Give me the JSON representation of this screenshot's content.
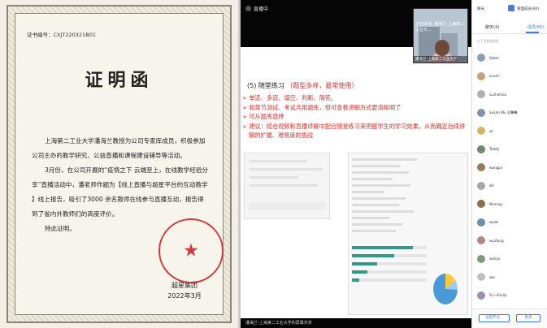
{
  "certificate": {
    "number": "证书编号：CXJT220321B01",
    "title": "证明函",
    "paragraphs": [
      "上海第二工业大学潘海兰教授为公司专家库成员，积极参加公司主办的教学研究、公益直播和课程建设辅导等活动。",
      "3月份，在公司开展的“疫情之下 云端至上，在线教学经验分享”直播活动中，潘老师作题为【线上直播与超星平台的互动教学 】线上报告，吸引了3000 余名教师在线参与直播互动，报告得到了省内外教师们的高度评价。",
      "特此证明。"
    ],
    "signer": "超星集团",
    "date": "2022年3月",
    "seal_color": "#d23c3c"
  },
  "video": {
    "room_title": "直播中",
    "camera_caption": "正在讲话: 潘海兰-上海第二工业大...",
    "camera_label": "潘海兰-上海第二工业大学",
    "slide_heading": "(5) 随堂练习",
    "slide_heading_note": "（题型多样，最常使用）",
    "bullets": [
      "单选、多选、填空、判断、简答。",
      "和章节测试、考试共用题库，但可查看讲解方式更清晰明了",
      "可从题库选择",
      "建议：结合视频和直播讲解中配合随堂练习来把握学生的学习效果，从而确定后续讲解的扩展、难易度的挑战"
    ],
    "bottom_caption": "潘海兰-上海第二工业大学的屏幕共享",
    "practice_results": [
      0.82,
      0.56,
      0.34,
      0.21,
      0.1
    ],
    "pie_shares": [
      0.14,
      0.12,
      0.74
    ]
  },
  "panel": {
    "header_left": "聊天",
    "header_right": "管理成员(80)",
    "tab_chat": "聊天(4)",
    "tab_members": "成员(80)",
    "note": "以下为参会成员",
    "users": [
      {
        "name": "Saber",
        "color": "#8aa0b8"
      },
      {
        "name": "sunoh",
        "color": "#c9a17a"
      },
      {
        "name": "suzhehieu",
        "color": "#b0b0b0"
      },
      {
        "name": "Susan Wu 吴馨馨",
        "color": "#7e95a8"
      },
      {
        "name": "wl",
        "color": "#d8b46a"
      },
      {
        "name": "Teddy",
        "color": "#6d8a6a"
      },
      {
        "name": "wangpv",
        "color": "#9c7c5e"
      },
      {
        "name": "wh",
        "color": "#a7a7a7"
      },
      {
        "name": "Wnniog",
        "color": "#88704d"
      },
      {
        "name": "wode",
        "color": "#6a8db0"
      },
      {
        "name": "wuzfang",
        "color": "#b48484"
      },
      {
        "name": "wuliyu",
        "color": "#7b9c7c"
      },
      {
        "name": "ww",
        "color": "#c0c0c0"
      },
      {
        "name": "X.L~Emily",
        "color": "#a08fb4"
      }
    ],
    "btn_invite": "全部不允...",
    "btn_more": "更多"
  }
}
